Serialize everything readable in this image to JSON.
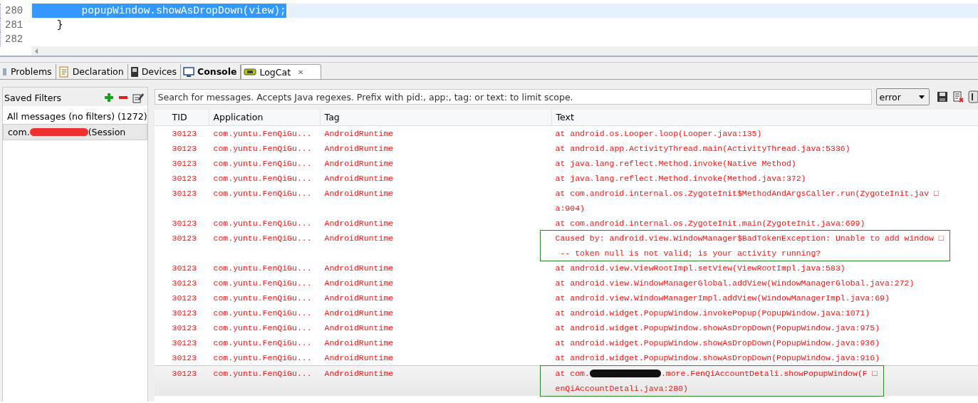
{
  "editor": {
    "lines": [
      {
        "number": "280",
        "code": "        popupWindow.showAsDropDown(view);",
        "selected": true
      },
      {
        "number": "281",
        "code": "    }",
        "selected": false
      },
      {
        "number": "282",
        "selected": false
      }
    ]
  },
  "tabs": [
    {
      "label": "Problems",
      "selected": false
    },
    {
      "label": "Declaration",
      "selected": false
    },
    {
      "label": "Devices",
      "selected": false
    },
    {
      "label": "Console",
      "selected": false
    },
    {
      "label": "LogCat",
      "selected": true,
      "close": "✕"
    }
  ],
  "filters": {
    "title": "Saved Filters",
    "items": [
      {
        "parts": [
          "All messages (no filters) (1272)"
        ],
        "selected": false
      },
      {
        "parts": [
          "com.",
          "(Session"
        ],
        "selected": true
      }
    ]
  },
  "search": {
    "placeholder": "Search for messages. Accepts Java regexes. Prefix with pid:, app:, tag: or text: to limit scope."
  },
  "level_select": {
    "value": "error"
  },
  "table": {
    "columns": [
      "TID",
      "Application",
      "Tag",
      "Text"
    ],
    "rows": [
      {
        "tid": "30123",
        "app": "com.yuntu.FenQiGu...",
        "tag": "AndroidRuntime",
        "lines": [
          [
            "at android.os.Looper.loop(Looper.java:135)"
          ]
        ],
        "boxed": false,
        "selected": false
      },
      {
        "tid": "30123",
        "app": "com.yuntu.FenQiGu...",
        "tag": "AndroidRuntime",
        "lines": [
          [
            "at android.app.ActivityThread.main(ActivityThread.java:5336)"
          ]
        ],
        "boxed": false,
        "selected": false
      },
      {
        "tid": "30123",
        "app": "com.yuntu.FenQiGu...",
        "tag": "AndroidRuntime",
        "lines": [
          [
            "at java.lang.reflect.Method.invoke(Native Method)"
          ]
        ],
        "boxed": false,
        "selected": false
      },
      {
        "tid": "30123",
        "app": "com.yuntu.FenQiGu...",
        "tag": "AndroidRuntime",
        "lines": [
          [
            "at java.lang.reflect.Method.invoke(Method.java:372)"
          ]
        ],
        "boxed": false,
        "selected": false
      },
      {
        "tid": "30123",
        "app": "com.yuntu.FenQiGu...",
        "tag": "AndroidRuntime",
        "lines": [
          [
            "at com.android.internal.os.ZygoteInit$MethodAndArgsCaller.run(ZygoteInit.jav □"
          ],
          [
            "a:904)"
          ]
        ],
        "boxed": false,
        "selected": false
      },
      {
        "tid": "30123",
        "app": "com.yuntu.FenQiGu...",
        "tag": "AndroidRuntime",
        "lines": [
          [
            "at com.android.internal.os.ZygoteInit.main(ZygoteInit.java:699)"
          ]
        ],
        "boxed": false,
        "selected": false
      },
      {
        "tid": "30123",
        "app": "com.yuntu.FenQiGu...",
        "tag": "AndroidRuntime",
        "lines": [
          [
            "Caused by: android.view.WindowManager$BadTokenException: Unable to add window □"
          ],
          [
            " -- token null is not valid; is your activity running?"
          ]
        ],
        "boxed": true,
        "selected": false
      },
      {
        "tid": "30123",
        "app": "com.yuntu.FenQiGu...",
        "tag": "AndroidRuntime",
        "lines": [
          [
            "at android.view.ViewRootImpl.setView(ViewRootImpl.java:583)"
          ]
        ],
        "boxed": false,
        "selected": false
      },
      {
        "tid": "30123",
        "app": "com.yuntu.FenQiGu...",
        "tag": "AndroidRuntime",
        "lines": [
          [
            "at android.view.WindowManagerGlobal.addView(WindowManagerGlobal.java:272)"
          ]
        ],
        "boxed": false,
        "selected": false
      },
      {
        "tid": "30123",
        "app": "com.yuntu.FenQiGu...",
        "tag": "AndroidRuntime",
        "lines": [
          [
            "at android.view.WindowManagerImpl.addView(WindowManagerImpl.java:69)"
          ]
        ],
        "boxed": false,
        "selected": false
      },
      {
        "tid": "30123",
        "app": "com.yuntu.FenQiGu...",
        "tag": "AndroidRuntime",
        "lines": [
          [
            "at android.widget.PopupWindow.invokePopup(PopupWindow.java:1071)"
          ]
        ],
        "boxed": false,
        "selected": false
      },
      {
        "tid": "30123",
        "app": "com.yuntu.FenQiGu...",
        "tag": "AndroidRuntime",
        "lines": [
          [
            "at android.widget.PopupWindow.showAsDropDown(PopupWindow.java:975)"
          ]
        ],
        "boxed": false,
        "selected": false
      },
      {
        "tid": "30123",
        "app": "com.yuntu.FenQiGu...",
        "tag": "AndroidRuntime",
        "lines": [
          [
            "at android.widget.PopupWindow.showAsDropDown(PopupWindow.java:936)"
          ]
        ],
        "boxed": false,
        "selected": false
      },
      {
        "tid": "30123",
        "app": "com.yuntu.FenQiGu...",
        "tag": "AndroidRuntime",
        "lines": [
          [
            "at android.widget.PopupWindow.showAsDropDown(PopupWindow.java:916)"
          ]
        ],
        "boxed": false,
        "selected": false
      },
      {
        "tid": "30123",
        "app": "com.yuntu.FenQiGu...",
        "tag": "AndroidRuntime",
        "lines": [
          [
            "at com.",
            ".more.FenQiAccountDetali.showPopupWindow(F □"
          ],
          [
            "enQiAccountDetali.java:280)"
          ]
        ],
        "boxed": true,
        "selected": true
      }
    ]
  }
}
